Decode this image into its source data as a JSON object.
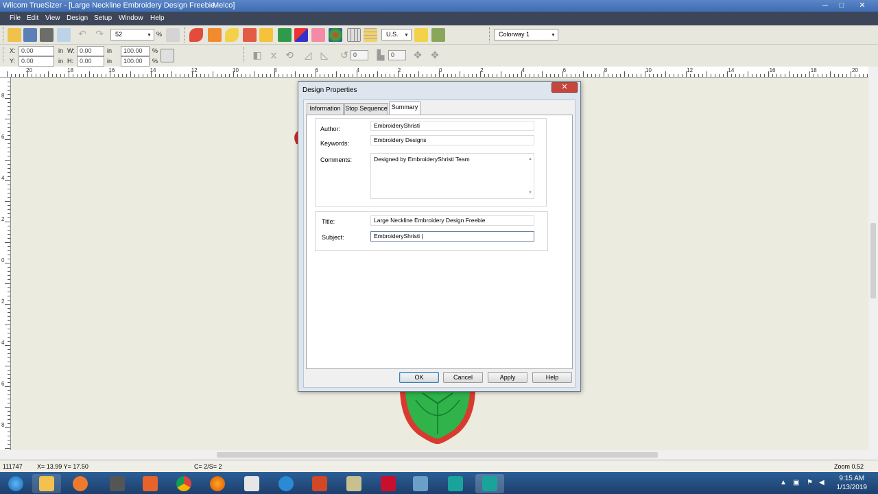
{
  "window": {
    "title": "Wilcom TrueSizer - [Large Neckline Embroidery Design Freebie",
    "title_suffix": "Melco]",
    "controls": [
      "─",
      "□",
      "✕"
    ]
  },
  "menu": [
    "File",
    "Edit",
    "View",
    "Design",
    "Setup",
    "Window",
    "Help"
  ],
  "toolbar": {
    "zoom_value": "52",
    "zoom_unit": "%",
    "units": "U.S.",
    "colorway": "Colorway 1",
    "x_label": "X:",
    "x_value": "0.00",
    "x_unit": "in",
    "y_label": "Y:",
    "y_value": "0.00",
    "y_unit": "in",
    "w_label": "W:",
    "w_value": "0.00",
    "w_unit": "in",
    "h_label": "H:",
    "h_value": "0.00",
    "h_unit": "in",
    "w_pct": "100.00",
    "h_pct": "100.00",
    "pct": "%",
    "rotate_value": "0",
    "slant_value": "0"
  },
  "ruler": {
    "labels": [
      "20",
      "18",
      "16",
      "14",
      "12",
      "10",
      "8",
      "6",
      "4",
      "2",
      "0",
      "2",
      "4",
      "6",
      "8",
      "10",
      "12",
      "14",
      "16",
      "18",
      "20"
    ],
    "vlabels": [
      "8",
      "6",
      "4",
      "2",
      "0",
      "2",
      "4",
      "6",
      "8"
    ]
  },
  "dialog": {
    "title": "Design Properties",
    "close": "✕",
    "tabs": [
      "Information",
      "Stop Sequence",
      "Summary"
    ],
    "fields": {
      "author_label": "Author:",
      "author_value": "EmbroideryShristi",
      "keywords_label": "Keywords:",
      "keywords_value": "Embroidery Designs",
      "comments_label": "Comments:",
      "comments_value": "Designed by EmbroideryShristi Team",
      "title_label": "Title:",
      "title_value": "Large Neckline Embroidery Design Freebie",
      "subject_label": "Subject:",
      "subject_value": "EmbroideryShristi |"
    },
    "buttons": {
      "ok": "OK",
      "cancel": "Cancel",
      "apply": "Apply",
      "help": "Help"
    }
  },
  "status": {
    "stitches": "111747",
    "coords": "X= 13.99 Y= 17.50",
    "colors": "C= 2/S= 2",
    "zoom": "Zoom 0.52"
  },
  "taskbar": {
    "time": "9:15 AM",
    "date": "1/13/2019",
    "apps": [
      "start-button",
      "file-explorer",
      "media-player",
      "app-3",
      "app-4",
      "chrome",
      "firefox",
      "notepad",
      "internet-explorer",
      "powerpoint",
      "app-10",
      "app-11",
      "app-12",
      "truesizer-1",
      "truesizer-2"
    ]
  },
  "colors": {
    "accent": "#3e6db3",
    "embroidery_green": "#2db34a",
    "embroidery_red": "#d02929"
  }
}
